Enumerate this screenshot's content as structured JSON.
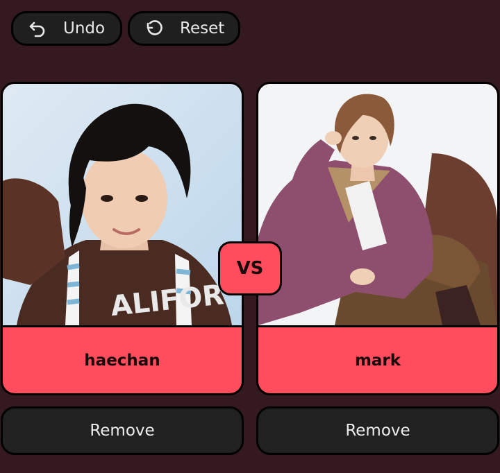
{
  "toolbar": {
    "undo_label": "Undo",
    "reset_label": "Reset"
  },
  "matchup": {
    "vs_label": "VS",
    "left": {
      "name": "haechan",
      "remove_label": "Remove"
    },
    "right": {
      "name": "mark",
      "remove_label": "Remove"
    }
  },
  "colors": {
    "background": "#341a1e",
    "accent": "#ff4d5e",
    "button_bg": "#1f1f1f"
  },
  "icons": {
    "undo": "undo-arrow-icon",
    "reset": "rotate-ccw-icon"
  }
}
